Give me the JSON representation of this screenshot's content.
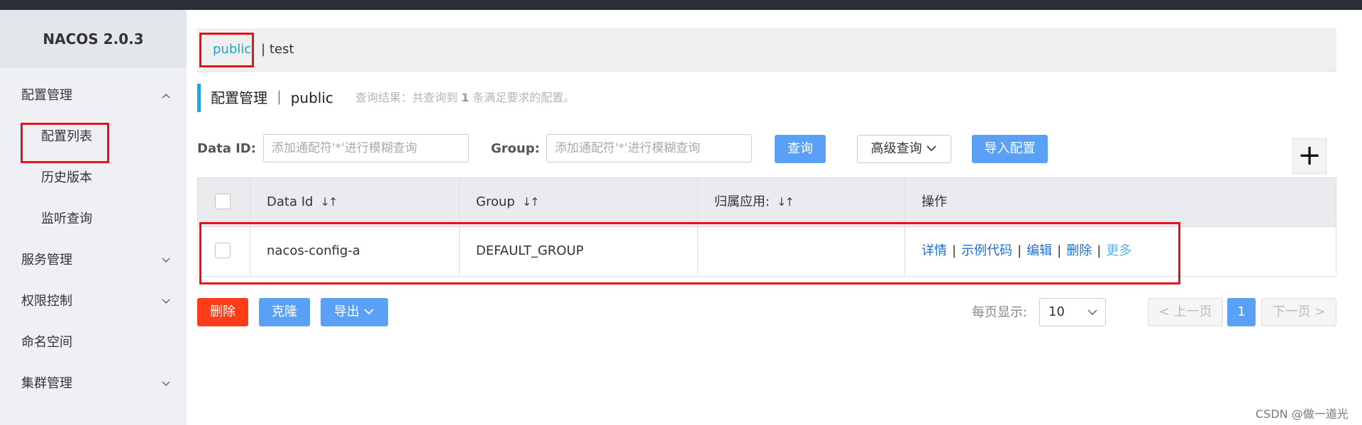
{
  "app": {
    "title": "NACOS 2.0.3"
  },
  "sidebar": {
    "items": [
      {
        "label": "配置管理",
        "chevron": "^"
      },
      {
        "label": "配置列表"
      },
      {
        "label": "历史版本"
      },
      {
        "label": "监听查询"
      },
      {
        "label": "服务管理",
        "chevron": "v"
      },
      {
        "label": "权限控制",
        "chevron": "v"
      },
      {
        "label": "命名空间"
      },
      {
        "label": "集群管理",
        "chevron": "v"
      }
    ]
  },
  "namespace": {
    "active": "public",
    "separator": "|",
    "other": "test"
  },
  "title": {
    "main": "配置管理 ｜ public",
    "hint_prefix": "查询结果：共查询到",
    "hint_count": "1",
    "hint_suffix": "条满足要求的配置。"
  },
  "search": {
    "data_id_label": "Data ID:",
    "data_id_placeholder": "添加通配符'*'进行模糊查询",
    "group_label": "Group:",
    "group_placeholder": "添加通配符'*'进行模糊查询",
    "query_button": "查询",
    "advanced_button": "高级查询",
    "import_button": "导入配置",
    "add_button": "+"
  },
  "table": {
    "columns": [
      "Data Id",
      "Group",
      "归属应用:",
      "操作"
    ],
    "sort_icon": "↓↑",
    "rows": [
      {
        "data_id": "nacos-config-a",
        "group": "DEFAULT_GROUP",
        "app": "",
        "actions": [
          "详情",
          "示例代码",
          "编辑",
          "删除",
          "更多"
        ]
      }
    ]
  },
  "bulk": {
    "delete": "删除",
    "clone": "克隆",
    "export": "导出"
  },
  "pager": {
    "page_size_label": "每页显示:",
    "page_size": "10",
    "prev": "上一页",
    "current": "1",
    "next": "下一页"
  },
  "watermark": "CSDN @做一道光",
  "colors": {
    "accent": "#5aa1f5",
    "danger": "#ff3c19",
    "highlight": "#e8101b",
    "link": "#1f6fd1"
  }
}
